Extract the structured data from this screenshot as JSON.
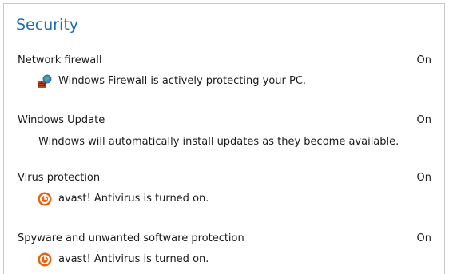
{
  "section": {
    "title": "Security"
  },
  "items": [
    {
      "name": "Network firewall",
      "status": "On",
      "description": "Windows Firewall is actively protecting your PC.",
      "icon": "firewall-icon"
    },
    {
      "name": "Windows Update",
      "status": "On",
      "description": "Windows will automatically install updates as they become available.",
      "icon": ""
    },
    {
      "name": "Virus protection",
      "status": "On",
      "description": "avast! Antivirus is turned on.",
      "icon": "avast-icon"
    },
    {
      "name": "Spyware and unwanted software protection",
      "status": "On",
      "description": "avast! Antivirus is turned on.",
      "icon": "avast-icon"
    }
  ],
  "colors": {
    "title": "#1f6fb5",
    "text": "#1a1a1a",
    "border": "#c9c9c9",
    "avast": "#e8630c"
  }
}
